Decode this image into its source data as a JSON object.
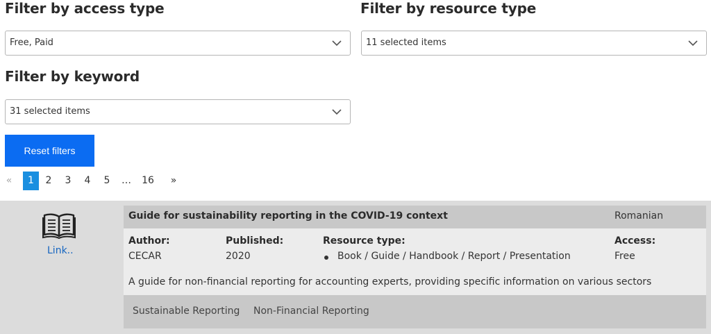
{
  "filters": {
    "access": {
      "title": "Filter by access type",
      "value": "Free, Paid"
    },
    "resource": {
      "title": "Filter by resource type",
      "value": "11 selected items"
    },
    "keyword": {
      "title": "Filter by keyword",
      "value": "31 selected items"
    },
    "reset_label": "Reset filters"
  },
  "pagination": {
    "prev": "«",
    "pages": [
      "1",
      "2",
      "3",
      "4",
      "5"
    ],
    "ellipsis": "…",
    "last": "16",
    "next": "»",
    "current": "1"
  },
  "result": {
    "link_label": "Link..",
    "title": "Guide for sustainability reporting in the COVID-19 context",
    "language": "Romanian",
    "author_label": "Author:",
    "author": "CECAR",
    "published_label": "Published:",
    "published": "2020",
    "resource_type_label": "Resource type:",
    "resource_types": "Book / Guide / Handbook / Report / Presentation",
    "access_label": "Access:",
    "access": "Free",
    "description": "A guide for non-financial reporting for accounting experts, providing specific information on various sectors",
    "tags": [
      "Sustainable Reporting",
      "Non-Financial Reporting"
    ]
  },
  "icons": {
    "chevron": "chevron-down-icon",
    "book": "open-book-icon"
  },
  "colors": {
    "primary_button": "#0b6cf2",
    "current_page": "#1a8fe0",
    "link": "#1565c0",
    "result_background": "#dcdcdc",
    "card_header": "#c8c8c8",
    "card_body": "#ececec"
  }
}
